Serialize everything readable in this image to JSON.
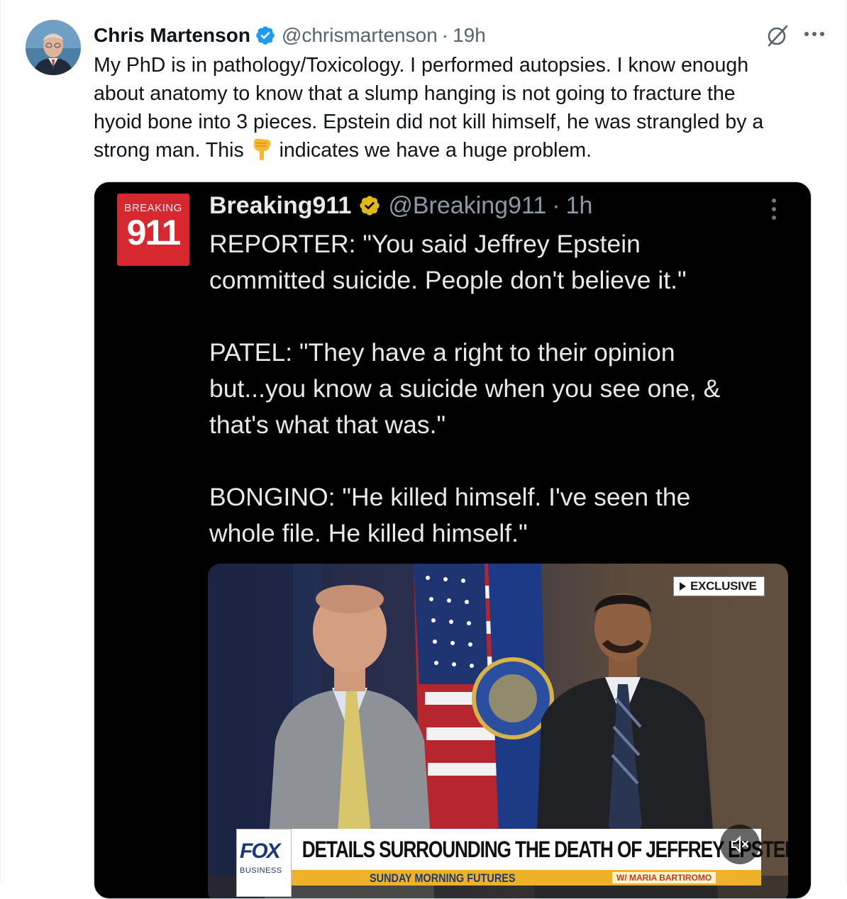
{
  "tweet": {
    "author_name": "Chris Martenson",
    "handle": "@chrismartenson",
    "separator": "·",
    "time": "19h",
    "lines": [
      "My PhD is in pathology/Toxicology.  I performed autopsies.  I know enough",
      "about anatomy to know that a slump hanging is not going to fracture the",
      "hyoid bone into 3 pieces.  Epstein did not kill himself, he was strangled by a"
    ],
    "last_line_before_emoji": "strong man.  This",
    "emoji": "backhand-index-pointing-down-emoji",
    "last_line_after_emoji": "indicates we have a huge problem."
  },
  "embedded": {
    "logo_top": "BREAKING",
    "logo_number": "911",
    "author_name": "Breaking911",
    "handle": "@Breaking911",
    "separator": "·",
    "time": "1h",
    "paragraph1": [
      "REPORTER: \"You said Jeffrey Epstein",
      "committed suicide. People don't believe it.\""
    ],
    "paragraph2": [
      "PATEL: \"They have a right to their opinion",
      "but...you know a suicide when you see one, &",
      "that's what that was.\""
    ],
    "paragraph3": [
      "BONGINO: \"He killed himself. I've seen the",
      "whole file. He killed himself.\""
    ]
  },
  "video": {
    "exclusive_label": "EXCLUSIVE",
    "network_logo": "FOX",
    "network_sub": "BUSINESS",
    "headline": "DETAILS SURROUNDING THE DEATH OF JEFFREY EPSTEIN",
    "show_name": "SUNDAY MORNING FUTURES",
    "host_label": "W/ MARIA BARTIROMO",
    "mute_icon": "speaker-muted-icon"
  },
  "colors": {
    "verified_blue": "#1d9bf0",
    "verified_gold": "#e2b719",
    "text_primary": "#0f1419",
    "text_secondary": "#536471",
    "breaking_red": "#d8282f"
  }
}
